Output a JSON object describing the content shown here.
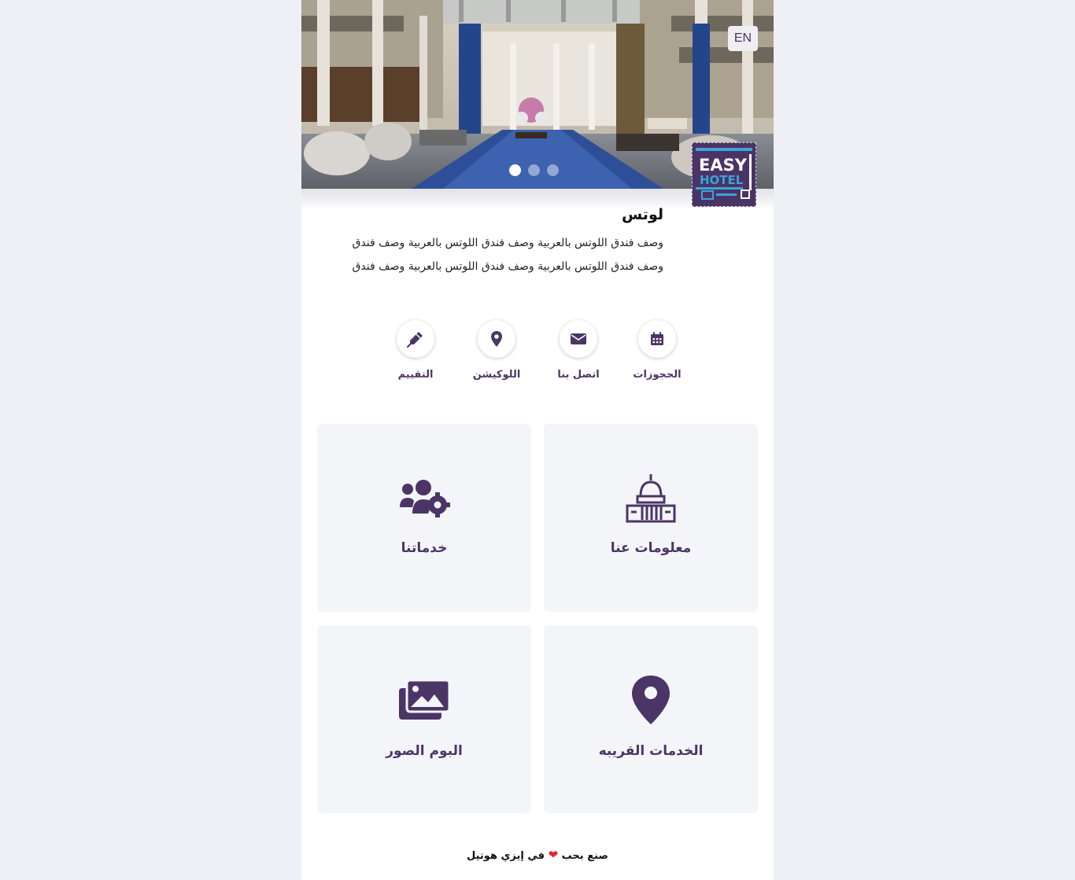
{
  "header": {
    "language_button": "EN",
    "slider_dots": 3,
    "active_dot": 0
  },
  "hotel": {
    "name": "لوتس",
    "description": "وصف فندق اللوتس بالعربية وصف فندق اللوتس بالعربية وصف فندق وصف فندق اللوتس بالعربية وصف فندق اللوتس بالعربية وصف فندق",
    "logo_text_top": "EASY",
    "logo_text_bottom": "HOTEL"
  },
  "actions": [
    {
      "label": "الحجوزات",
      "icon": "calendar-icon"
    },
    {
      "label": "اتصل بنا",
      "icon": "envelope-icon"
    },
    {
      "label": "اللوكيشن",
      "icon": "map-pin-icon"
    },
    {
      "label": "التقييم",
      "icon": "pen-icon"
    }
  ],
  "cards": [
    {
      "title": "معلومات عنا",
      "icon": "building-icon"
    },
    {
      "title": "خدماتنا",
      "icon": "users-gear-icon"
    },
    {
      "title": "الخدمات القريبه",
      "icon": "map-marker-icon"
    },
    {
      "title": "البوم الصور",
      "icon": "images-icon"
    }
  ],
  "footer": {
    "made_with": "صنع بحب",
    "in": "في إيزي هوتيل",
    "heart": "❤"
  },
  "colors": {
    "accent": "#4b3566",
    "card_bg": "#f4f5f8",
    "page_bg": "#eef0f5",
    "heart": "#e0262f"
  }
}
